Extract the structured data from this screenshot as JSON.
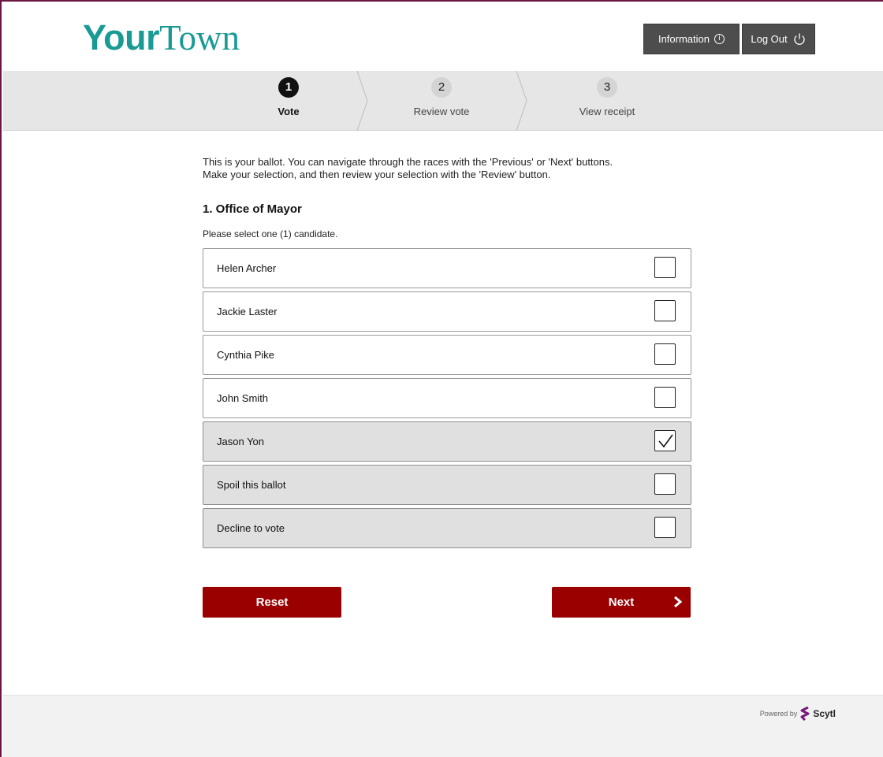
{
  "header": {
    "logo_part1": "Your",
    "logo_part2": "Town",
    "info_label": "Information",
    "logout_label": "Log Out"
  },
  "stepper": [
    {
      "number": "1",
      "label": "Vote",
      "state": "active"
    },
    {
      "number": "2",
      "label": "Review vote",
      "state": "inactive"
    },
    {
      "number": "3",
      "label": "View receipt",
      "state": "inactive"
    }
  ],
  "main": {
    "intro_line1": "This is your ballot. You can navigate through the races with the 'Previous' or 'Next' buttons.",
    "intro_line2": "Make your selection, and then review your selection with the 'Review' button.",
    "race_title": "1. Office of Mayor",
    "instruction": "Please select one (1) candidate."
  },
  "options": [
    {
      "label": "Helen Archer",
      "checked": false
    },
    {
      "label": "Jackie Laster",
      "checked": false
    },
    {
      "label": "Cynthia Pike",
      "checked": false
    },
    {
      "label": "John Smith",
      "checked": false
    },
    {
      "label": "Jason Yon",
      "checked": true
    },
    {
      "label": "Spoil this ballot",
      "checked": false
    },
    {
      "label": "Decline to vote",
      "checked": false
    }
  ],
  "actions": {
    "reset_label": "Reset",
    "next_label": "Next"
  },
  "footer": {
    "powered_by": "Powered by",
    "brand": "Scytl"
  },
  "colors": {
    "brand_teal": "#1a9a94",
    "action_red": "#9b0000",
    "header_button": "#4d4d4d",
    "frame": "#6b1540"
  }
}
